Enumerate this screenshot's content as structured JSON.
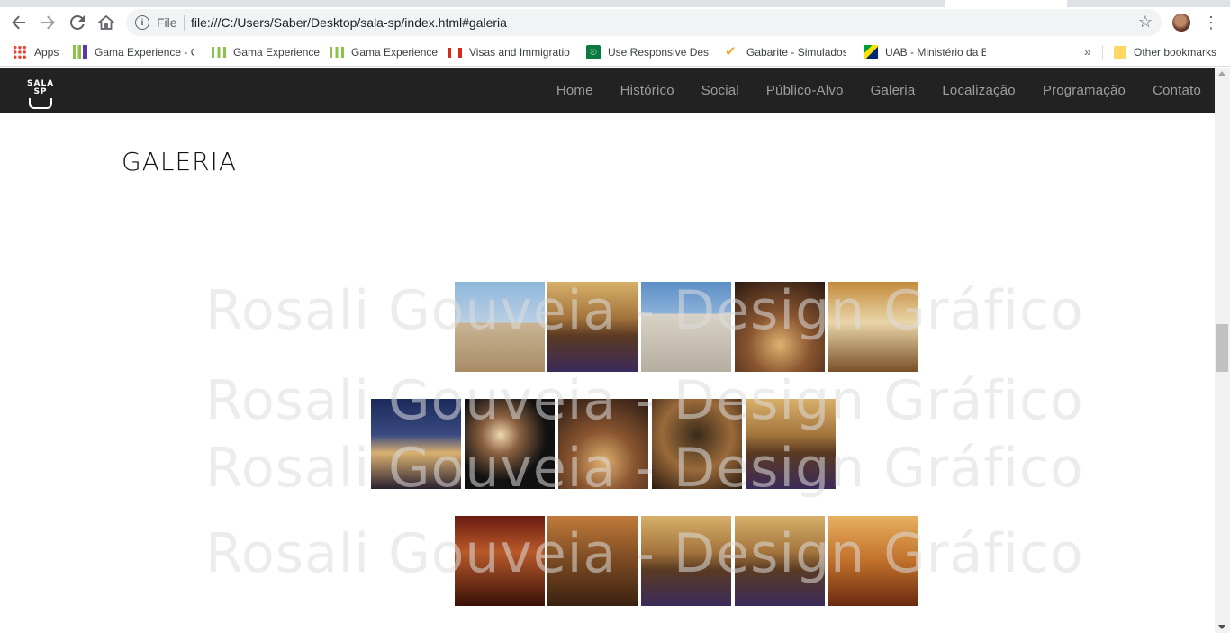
{
  "browser": {
    "omnibox": {
      "scheme_label": "File",
      "url": "file:///C:/Users/Saber/Desktop/sala-sp/index.html#galeria"
    },
    "bookmarks": [
      {
        "label": "Apps",
        "icon": "apps-grid-icon"
      },
      {
        "label": "Gama Experience - C",
        "icon": "gama-icon"
      },
      {
        "label": "Gama Experience",
        "icon": "gama-icon"
      },
      {
        "label": "Gama Experience",
        "icon": "gama-icon"
      },
      {
        "label": "Visas and Immigratio",
        "icon": "canada-flag-icon"
      },
      {
        "label": "Use Responsive Desig",
        "icon": "responsive-icon"
      },
      {
        "label": "Gabarite - Simulados",
        "icon": "check-icon"
      },
      {
        "label": "UAB - Ministério da E",
        "icon": "brazil-flag-icon"
      }
    ],
    "more_bookmarks": "»",
    "other_bookmarks": "Other bookmarks"
  },
  "site": {
    "logo_text": "SALA SP",
    "nav": [
      "Home",
      "Histórico",
      "Social",
      "Público-Alvo",
      "Galeria",
      "Localização",
      "Programação",
      "Contato"
    ],
    "section_title": "GALERIA",
    "watermark_text": "Rosali Gouveia - Design Gráfico"
  },
  "gallery": {
    "rows": [
      [
        {
          "icon": "building-tower-photo"
        },
        {
          "icon": "concert-hall-photo"
        },
        {
          "icon": "building-facade-photo"
        },
        {
          "icon": "orchestra-photo"
        },
        {
          "icon": "hall-interior-photo"
        }
      ],
      [
        {
          "icon": "building-night-photo"
        },
        {
          "icon": "conductor-photo"
        },
        {
          "icon": "orchestra-photo"
        },
        {
          "icon": "conductor-orchestra-photo"
        },
        {
          "icon": "concert-hall-photo"
        }
      ],
      [
        {
          "icon": "orchestra-stage-photo"
        },
        {
          "icon": "audience-hall-photo"
        },
        {
          "icon": "concert-hall-photo"
        },
        {
          "icon": "concert-hall-photo"
        },
        {
          "icon": "auditorium-photo"
        }
      ]
    ]
  }
}
